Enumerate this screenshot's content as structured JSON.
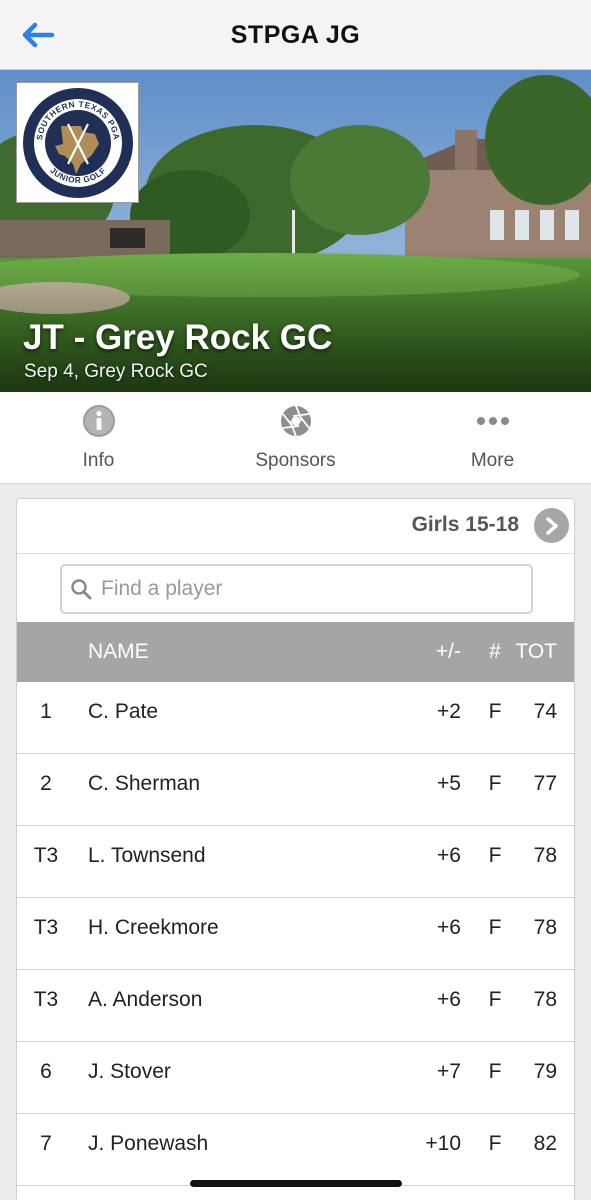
{
  "nav": {
    "title": "STPGA JG",
    "back_icon": "arrow-left-icon",
    "accent_color": "#2f80ed"
  },
  "hero": {
    "title": "JT - Grey Rock GC",
    "subtitle": "Sep 4, Grey Rock GC",
    "logo": {
      "top_text": "SOUTHERN TEXAS PGA",
      "bottom_text": "JUNIOR GOLF",
      "ring_color": "#1f2f55",
      "gold_color": "#b08d57"
    }
  },
  "tabs": [
    {
      "label": "Info",
      "icon": "info-icon"
    },
    {
      "label": "Sponsors",
      "icon": "aperture-icon"
    },
    {
      "label": "More",
      "icon": "more-dots-icon"
    }
  ],
  "leaderboard": {
    "division": "Girls 15-18",
    "search_placeholder": "Find a player",
    "columns": {
      "pos": "",
      "name": "NAME",
      "to_par": "+/-",
      "thru": "#",
      "total": "TOT"
    },
    "header_color": "#a5a5a5",
    "rows": [
      {
        "pos": "1",
        "name": "C. Pate",
        "to_par": "+2",
        "thru": "F",
        "total": "74"
      },
      {
        "pos": "2",
        "name": "C. Sherman",
        "to_par": "+5",
        "thru": "F",
        "total": "77"
      },
      {
        "pos": "T3",
        "name": "L. Townsend",
        "to_par": "+6",
        "thru": "F",
        "total": "78"
      },
      {
        "pos": "T3",
        "name": "H. Creekmore",
        "to_par": "+6",
        "thru": "F",
        "total": "78"
      },
      {
        "pos": "T3",
        "name": "A. Anderson",
        "to_par": "+6",
        "thru": "F",
        "total": "78"
      },
      {
        "pos": "6",
        "name": "J. Stover",
        "to_par": "+7",
        "thru": "F",
        "total": "79"
      },
      {
        "pos": "7",
        "name": "J. Ponewash",
        "to_par": "+10",
        "thru": "F",
        "total": "82"
      }
    ]
  }
}
